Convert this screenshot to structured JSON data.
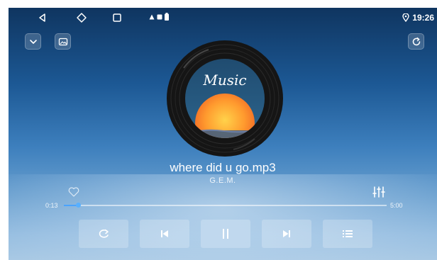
{
  "status_bar": {
    "nav_icons": [
      "back-icon",
      "home-icon",
      "recents-icon"
    ],
    "notification_icons": [
      "warning-icon",
      "media-icon",
      "battery-icon"
    ],
    "location_icon": "location-pin-icon",
    "time": "19:26"
  },
  "top_controls": {
    "left": [
      "collapse-chevron-icon",
      "gallery-icon"
    ],
    "right": "refresh-icon"
  },
  "album_art": {
    "label": "Music"
  },
  "track": {
    "title": "where did u go.mp3",
    "artist": "G.E.M."
  },
  "player": {
    "favorite_icon": "heart-icon",
    "equalizer_icon": "equalizer-icon",
    "elapsed": "0:13",
    "duration": "5:00",
    "progress_fraction": 0.043,
    "progress_color": "#4aa3ff"
  },
  "controls": [
    "repeat-icon",
    "previous-icon",
    "pause-icon",
    "next-icon",
    "playlist-icon"
  ],
  "colors": {
    "background_top": "#0f3560",
    "background_bottom": "#a9c9e4",
    "accent": "#4aa3ff"
  }
}
